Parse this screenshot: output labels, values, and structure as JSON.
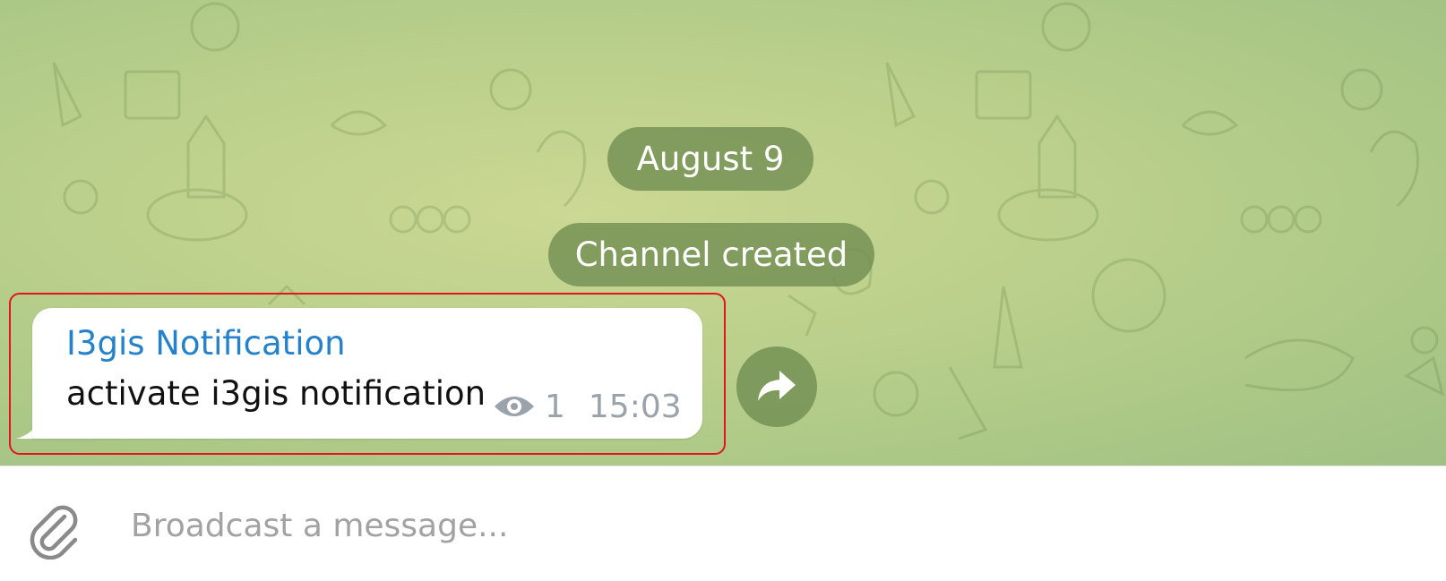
{
  "chat": {
    "date_separator": "August 9",
    "service_message": "Channel created",
    "message": {
      "sender": "I3gis Notification",
      "text": "activate i3gis notification",
      "views": "1",
      "time": "15:03"
    }
  },
  "composer": {
    "placeholder": "Broadcast a message..."
  },
  "icons": {
    "attach": "paperclip-icon",
    "forward": "forward-arrow-icon",
    "views": "eye-icon"
  },
  "colors": {
    "sender_name": "#2481cc",
    "highlight_border": "#e3141c",
    "pill_background": "#6e8c50",
    "meta_text": "#9aa3ab"
  }
}
